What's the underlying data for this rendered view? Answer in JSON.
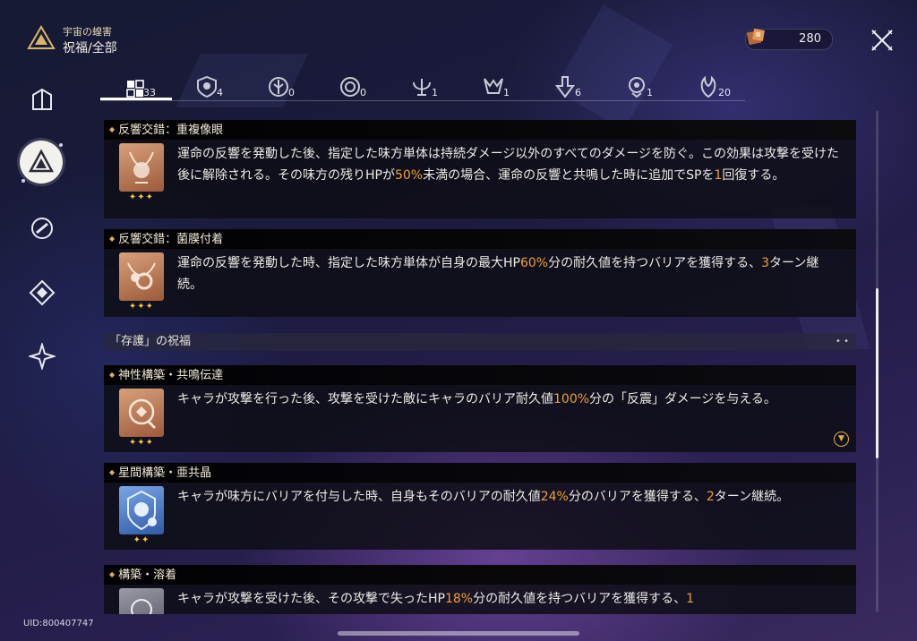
{
  "header": {
    "subtitle": "宇宙の蝗害",
    "title": "祝福/全部",
    "currency_value": "280"
  },
  "tabs": [
    {
      "name": "all",
      "count": "33"
    },
    {
      "name": "preservation",
      "count": "4"
    },
    {
      "name": "remembrance",
      "count": "0"
    },
    {
      "name": "nihility",
      "count": "0"
    },
    {
      "name": "abundance",
      "count": "1"
    },
    {
      "name": "the-hunt",
      "count": "1"
    },
    {
      "name": "destruction",
      "count": "6"
    },
    {
      "name": "elation",
      "count": "1"
    },
    {
      "name": "propagation",
      "count": "20"
    }
  ],
  "cards": [
    {
      "title": "反響交錯：重複像眼",
      "stars": "✦✦✦",
      "text_a": "運命の反響を発動した後、指定した味方単体は持続ダメージ以外のすべてのダメージを防ぐ。この効果は攻撃を受けた後に解除される。その味方の残りHPが",
      "hl_1": "50%",
      "text_b": "未満の場合、運命の反響と共鳴した時に追加でSPを",
      "hl_2": "1",
      "text_c": "回復する。"
    },
    {
      "title": "反響交錯：菌膜付着",
      "stars": "✦✦✦",
      "text_a": "運命の反響を発動した時、指定した味方単体が自身の最大HP",
      "hl_1": "60%",
      "text_b": "分の耐久値を持つバリアを獲得する、",
      "hl_2": "3",
      "text_c": "ターン継続。"
    },
    {
      "title": "神性構築・共鳴伝達",
      "stars": "✦✦✦",
      "text_a": "キャラが攻撃を行った後、攻撃を受けた敵にキャラのバリア耐久値",
      "hl_1": "100%",
      "text_b": "分の「反震」ダメージを与える。"
    },
    {
      "title": "星間構築・亜共晶",
      "stars": "✦✦",
      "text_a": "キャラが味方にバリアを付与した時、自身もそのバリアの耐久値",
      "hl_1": "24%",
      "text_b": "分のバリアを獲得する、",
      "hl_2": "2",
      "text_c": "ターン継続。"
    },
    {
      "title": "構築・溶着",
      "text_a": "キャラが攻撃を受けた後、その攻撃で失ったHP",
      "hl_1": "18%",
      "text_b": "分の耐久値を持つバリアを獲得する、",
      "hl_2": "1"
    }
  ],
  "section": {
    "title": "「存護」の祝福",
    "dots": "• •"
  },
  "footer": {
    "uid": "UID:800407747"
  },
  "colors": {
    "accent_orange": "#f0a030",
    "star_gold": "#f5c542",
    "icon_gold_frame": "#c68a5c",
    "icon_blue_frame": "#4a78c8"
  }
}
